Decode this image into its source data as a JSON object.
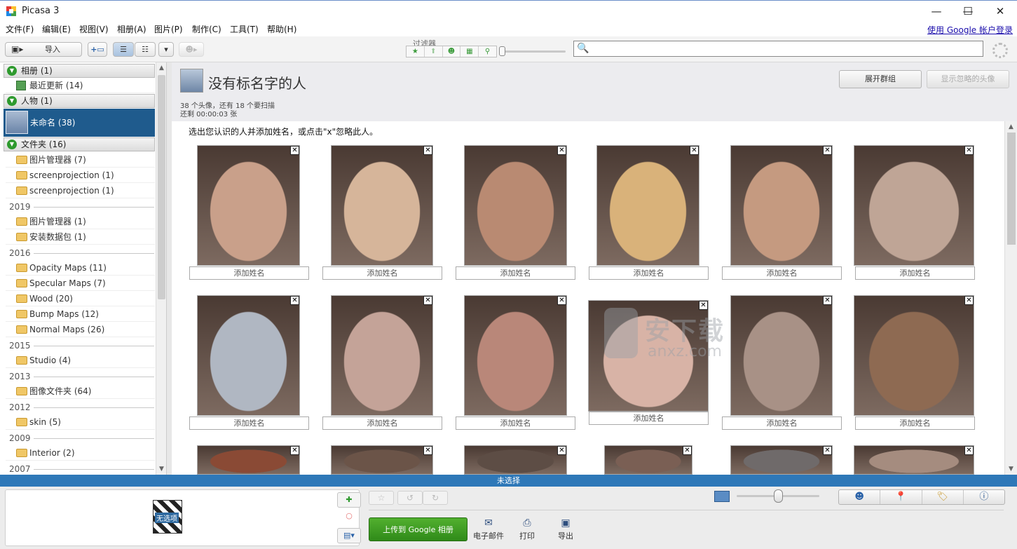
{
  "app": {
    "title": "Picasa 3"
  },
  "window_controls": {
    "minimize": "—",
    "maximize": "☐",
    "close": "✕"
  },
  "menu": [
    "文件(F)",
    "编辑(E)",
    "视图(V)",
    "相册(A)",
    "图片(P)",
    "制作(C)",
    "工具(T)",
    "帮助(H)"
  ],
  "login_link": "使用 Google 帐户登录",
  "toolbar": {
    "import_label": "导入",
    "filter_label": "过滤器",
    "search_placeholder": ""
  },
  "sidebar": {
    "albums": {
      "label": "相册 (1)",
      "items": [
        {
          "label": "最近更新 (14)"
        }
      ]
    },
    "people": {
      "label": "人物 (1)",
      "selected": "未命名 (38)"
    },
    "folders": {
      "label": "文件夹 (16)"
    },
    "folder_items": [
      {
        "label": "图片管理器 (7)"
      },
      {
        "label": "screenprojection (1)"
      },
      {
        "label": "screenprojection (1)"
      },
      {
        "year": "2019"
      },
      {
        "label": "图片管理器 (1)"
      },
      {
        "label": "安装数据包 (1)"
      },
      {
        "year": "2016"
      },
      {
        "label": "Opacity Maps (11)"
      },
      {
        "label": "Specular Maps (7)"
      },
      {
        "label": "Wood (20)"
      },
      {
        "label": "Bump Maps (12)"
      },
      {
        "label": "Normal Maps (26)"
      },
      {
        "year": "2015"
      },
      {
        "label": "Studio (4)"
      },
      {
        "year": "2013"
      },
      {
        "label": "图像文件夹 (64)"
      },
      {
        "year": "2012"
      },
      {
        "label": "skin (5)"
      },
      {
        "year": "2009"
      },
      {
        "label": "Interior (2)"
      },
      {
        "year": "2007"
      }
    ]
  },
  "main": {
    "title": "没有标名字的人",
    "stats_line1": "38 个头像，还有 18 个要扫描",
    "stats_line2": "还剩 00:00:03 张",
    "expand_button": "展开群组",
    "show_ignored_button": "显示忽略的头像",
    "instruction": "选出您认识的人并添加姓名，或点击\"x\"忽略此人。",
    "add_name_label": "添加姓名",
    "close_glyph": "✕"
  },
  "watermark": {
    "line1": "安下载",
    "line2": "anxz.com"
  },
  "status_bar": "未选择",
  "bottom": {
    "tray_label": "无选项",
    "upload_label": "上传到 Google 相册",
    "email_label": "电子邮件",
    "print_label": "打印",
    "export_label": "导出"
  },
  "colors": {
    "selection": "#1f5b8d",
    "status_bar": "#2e78b8",
    "upload_green": "#3d9c22"
  }
}
